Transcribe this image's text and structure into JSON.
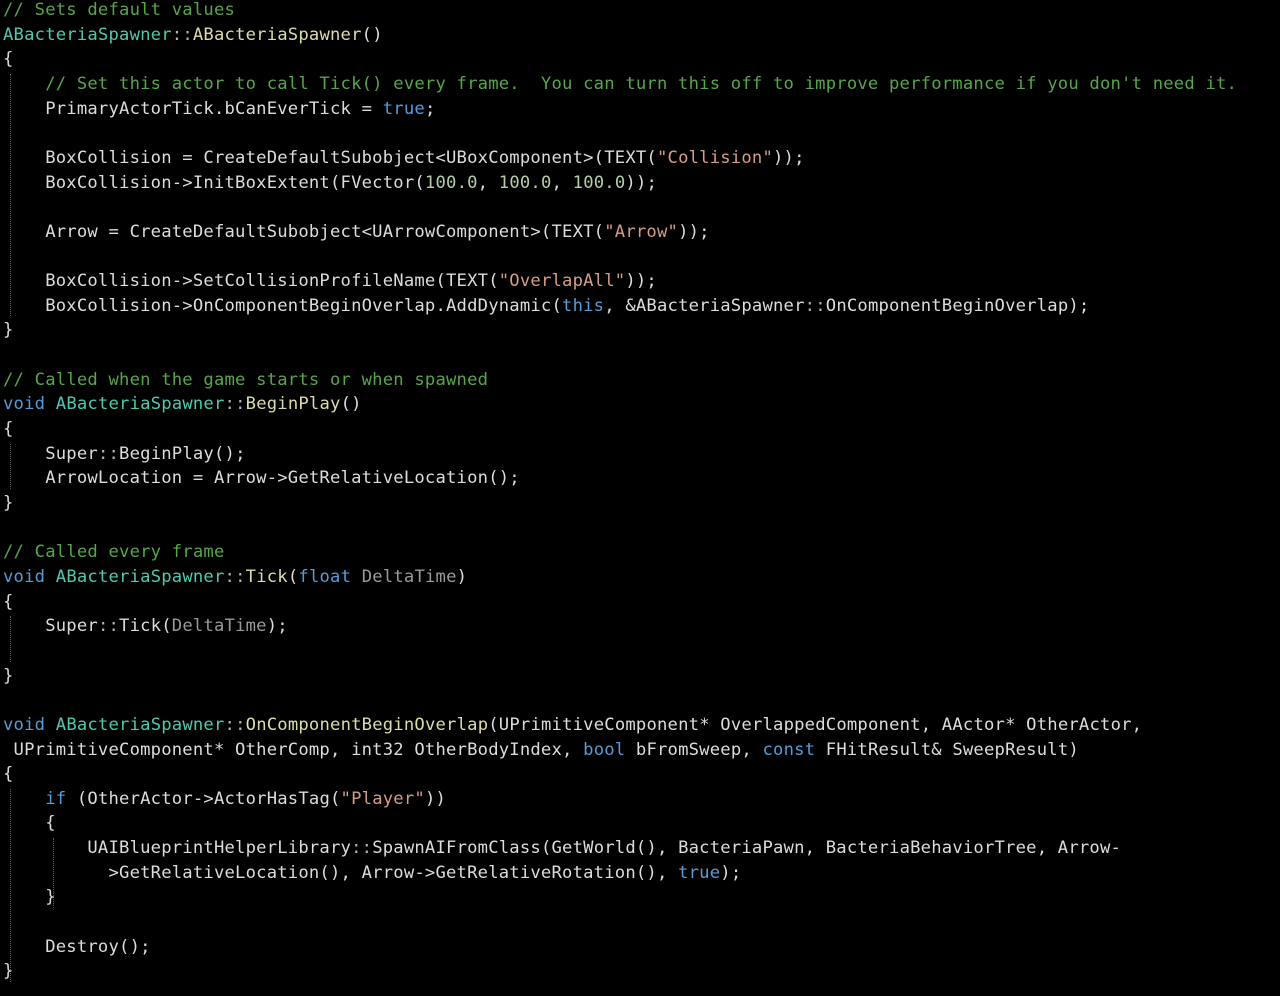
{
  "editor": {
    "background": "#000000",
    "token_colors": {
      "plain": "#dcdcdc",
      "comment": "#57a64a",
      "keyword": "#569cd6",
      "type": "#4ec9b0",
      "function": "#dcdcaa",
      "string": "#d69d85",
      "number": "#b5cea8",
      "parameter": "#9a9a9a",
      "punctuation": "#b4b4b4"
    },
    "lines": [
      [
        [
          "comment",
          "// Sets default values"
        ]
      ],
      [
        [
          "type",
          "ABacteriaSpawner"
        ],
        [
          "punct",
          "::"
        ],
        [
          "func",
          "ABacteriaSpawner"
        ],
        [
          "plain",
          "()"
        ]
      ],
      [
        [
          "plain",
          "{"
        ]
      ],
      [
        [
          "comment",
          "    // Set this actor to call Tick() every frame.  You can turn this off to improve performance if you don't need it."
        ]
      ],
      [
        [
          "plain",
          "    PrimaryActorTick.bCanEverTick = "
        ],
        [
          "keyword",
          "true"
        ],
        [
          "plain",
          ";"
        ]
      ],
      [],
      [
        [
          "plain",
          "    BoxCollision = CreateDefaultSubobject<UBoxComponent>(TEXT("
        ],
        [
          "string",
          "\"Collision\""
        ],
        [
          "plain",
          "));"
        ]
      ],
      [
        [
          "plain",
          "    BoxCollision->InitBoxExtent(FVector("
        ],
        [
          "number",
          "100.0"
        ],
        [
          "plain",
          ", "
        ],
        [
          "number",
          "100.0"
        ],
        [
          "plain",
          ", "
        ],
        [
          "number",
          "100.0"
        ],
        [
          "plain",
          "));"
        ]
      ],
      [],
      [
        [
          "plain",
          "    Arrow = CreateDefaultSubobject<UArrowComponent>(TEXT("
        ],
        [
          "string",
          "\"Arrow\""
        ],
        [
          "plain",
          "));"
        ]
      ],
      [],
      [
        [
          "plain",
          "    BoxCollision->SetCollisionProfileName(TEXT("
        ],
        [
          "string",
          "\"OverlapAll\""
        ],
        [
          "plain",
          "));"
        ]
      ],
      [
        [
          "plain",
          "    BoxCollision->OnComponentBeginOverlap.AddDynamic("
        ],
        [
          "keyword",
          "this"
        ],
        [
          "plain",
          ", &ABacteriaSpawner"
        ],
        [
          "punct",
          "::"
        ],
        [
          "plain",
          "OnComponentBeginOverlap);"
        ]
      ],
      [
        [
          "plain",
          "}"
        ]
      ],
      [],
      [
        [
          "comment",
          "// Called when the game starts or when spawned"
        ]
      ],
      [
        [
          "keyword",
          "void"
        ],
        [
          "plain",
          " "
        ],
        [
          "type",
          "ABacteriaSpawner"
        ],
        [
          "punct",
          "::"
        ],
        [
          "func",
          "BeginPlay"
        ],
        [
          "plain",
          "()"
        ]
      ],
      [
        [
          "plain",
          "{"
        ]
      ],
      [
        [
          "plain",
          "    Super"
        ],
        [
          "punct",
          "::"
        ],
        [
          "plain",
          "BeginPlay();"
        ]
      ],
      [
        [
          "plain",
          "    ArrowLocation = Arrow->GetRelativeLocation();"
        ]
      ],
      [
        [
          "plain",
          "}"
        ]
      ],
      [],
      [
        [
          "comment",
          "// Called every frame"
        ]
      ],
      [
        [
          "keyword",
          "void"
        ],
        [
          "plain",
          " "
        ],
        [
          "type",
          "ABacteriaSpawner"
        ],
        [
          "punct",
          "::"
        ],
        [
          "func",
          "Tick"
        ],
        [
          "plain",
          "("
        ],
        [
          "keyword",
          "float"
        ],
        [
          "plain",
          " "
        ],
        [
          "param",
          "DeltaTime"
        ],
        [
          "plain",
          ")"
        ]
      ],
      [
        [
          "plain",
          "{"
        ]
      ],
      [
        [
          "plain",
          "    Super"
        ],
        [
          "punct",
          "::"
        ],
        [
          "plain",
          "Tick("
        ],
        [
          "param",
          "DeltaTime"
        ],
        [
          "plain",
          ");"
        ]
      ],
      [],
      [
        [
          "plain",
          "}"
        ]
      ],
      [],
      [
        [
          "keyword",
          "void"
        ],
        [
          "plain",
          " "
        ],
        [
          "type",
          "ABacteriaSpawner"
        ],
        [
          "punct",
          "::"
        ],
        [
          "func",
          "OnComponentBeginOverlap"
        ],
        [
          "plain",
          "(UPrimitiveComponent* OverlappedComponent, AActor* OtherActor,"
        ]
      ],
      [
        [
          "plain",
          " UPrimitiveComponent* OtherComp, int32 OtherBodyIndex, "
        ],
        [
          "keyword",
          "bool"
        ],
        [
          "plain",
          " bFromSweep, "
        ],
        [
          "keyword",
          "const"
        ],
        [
          "plain",
          " FHitResult& SweepResult)"
        ]
      ],
      [
        [
          "plain",
          "{"
        ]
      ],
      [
        [
          "keyword",
          "    if"
        ],
        [
          "plain",
          " (OtherActor->ActorHasTag("
        ],
        [
          "string",
          "\"Player\""
        ],
        [
          "plain",
          "))"
        ]
      ],
      [
        [
          "plain",
          "    {"
        ]
      ],
      [
        [
          "plain",
          "        UAIBlueprintHelperLibrary"
        ],
        [
          "punct",
          "::"
        ],
        [
          "plain",
          "SpawnAIFromClass(GetWorld(), BacteriaPawn, BacteriaBehaviorTree, Arrow-"
        ]
      ],
      [
        [
          "plain",
          "          >GetRelativeLocation(), Arrow->GetRelativeRotation(), "
        ],
        [
          "keyword",
          "true"
        ],
        [
          "plain",
          ");"
        ]
      ],
      [
        [
          "plain",
          "    }"
        ]
      ],
      [],
      [
        [
          "plain",
          "    Destroy();"
        ]
      ],
      [
        [
          "plain",
          "}"
        ]
      ]
    ]
  }
}
